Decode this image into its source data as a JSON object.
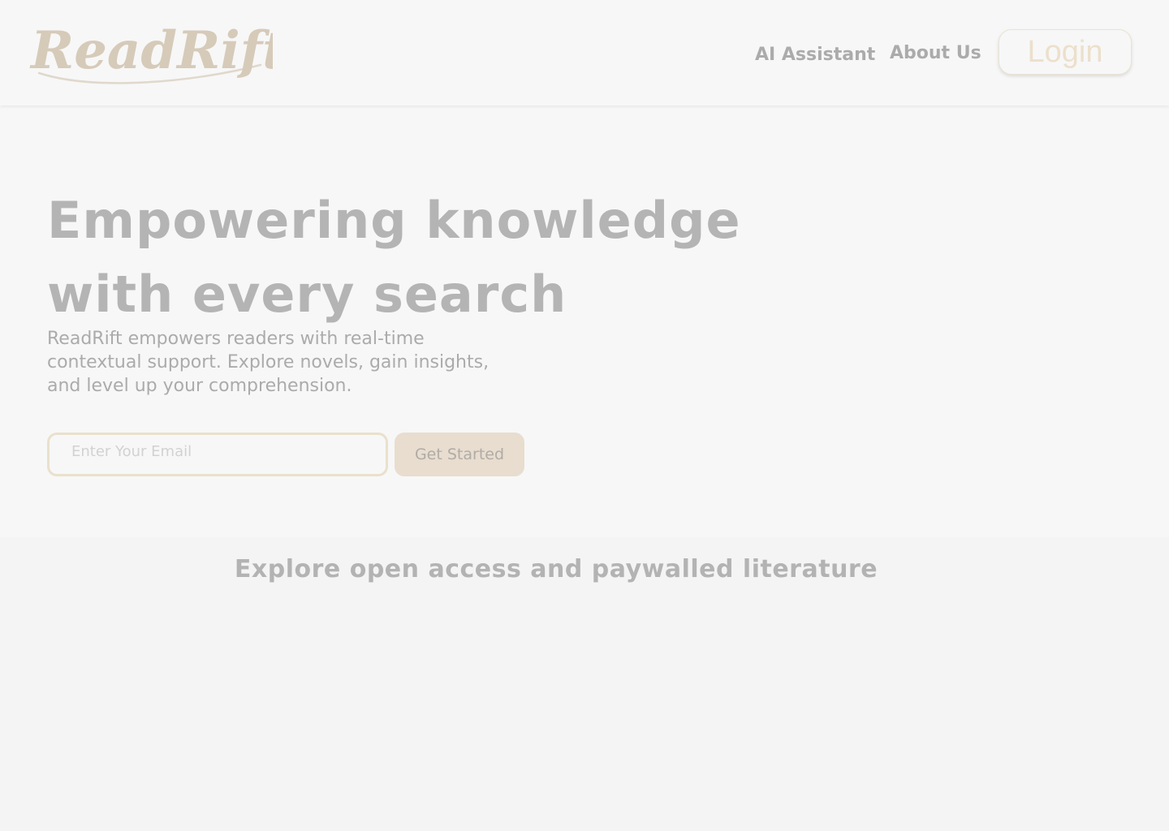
{
  "header": {
    "logo_text": "ReadRift",
    "nav": {
      "ai_assistant": "AI Assistant",
      "about_us": "About Us"
    },
    "login_label": "Login"
  },
  "hero": {
    "title_line1": "Empowering knowledge",
    "title_line2": "with every search",
    "subtitle": "ReadRift empowers readers with real-time contextual support. Explore novels, gain insights, and level up your comprehension.",
    "email_placeholder": "Enter Your Email",
    "cta_label": "Get Started"
  },
  "explore": {
    "title": "Explore open access and paywalled literature"
  },
  "colors": {
    "brand_beige": "#d8cdbc",
    "cta_background": "#e8ddcf",
    "text_gray": "#b4b4b4",
    "page_background": "#f7f7f7"
  }
}
